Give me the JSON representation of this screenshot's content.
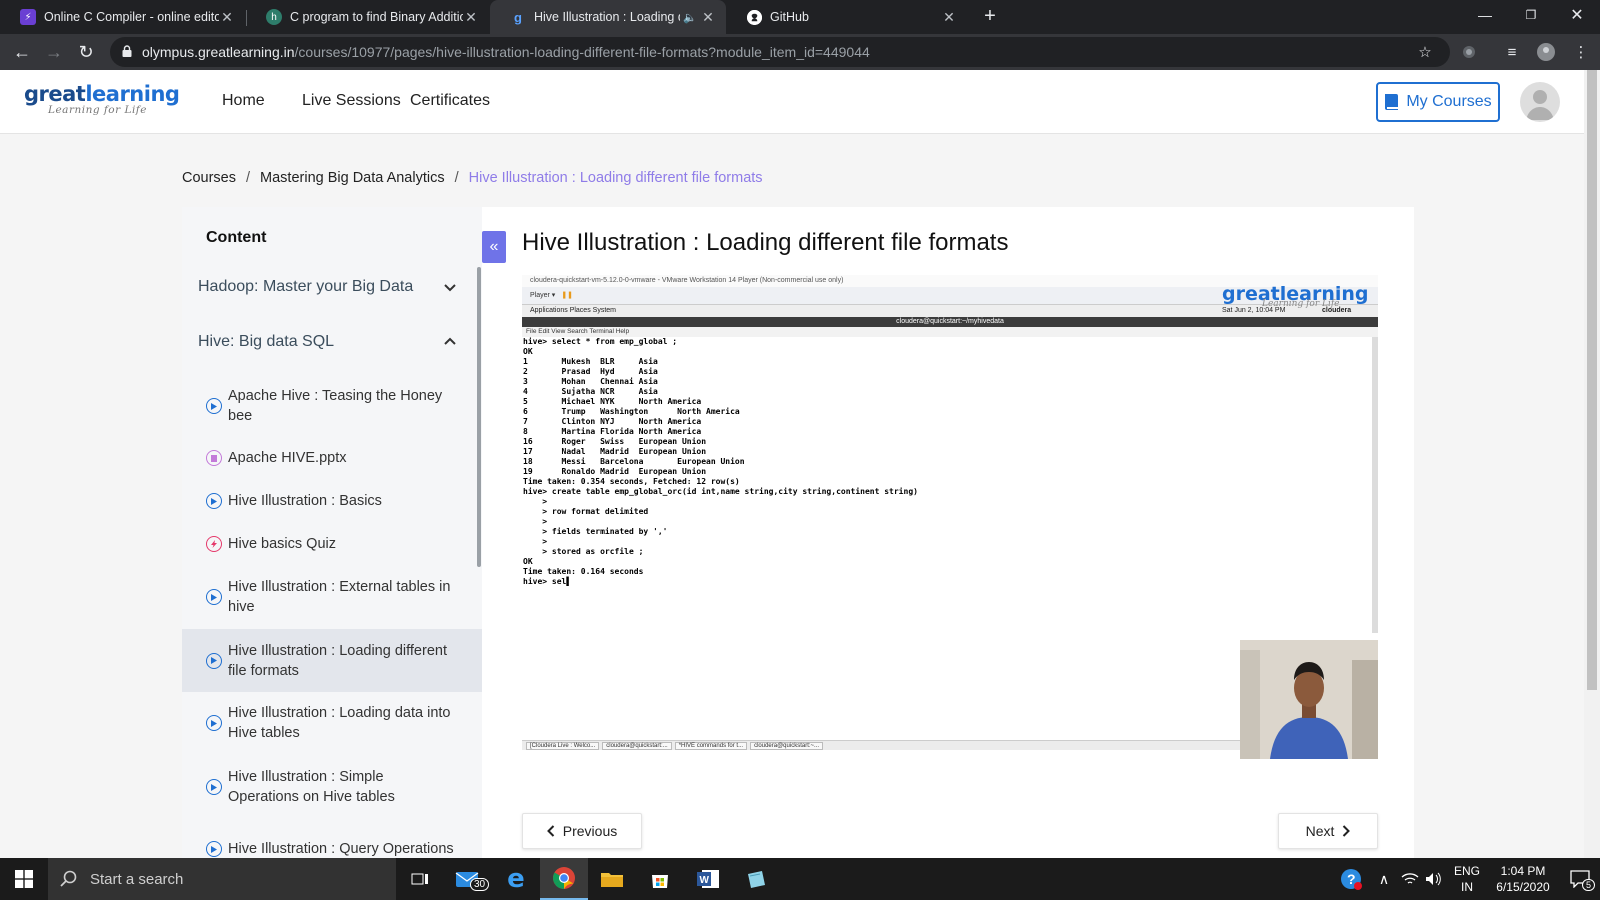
{
  "browser": {
    "tabs": [
      {
        "title": "Online C Compiler - online editor",
        "icon": "bolt-icon",
        "color": "#6a3fd3"
      },
      {
        "title": "C program to find Binary Additio",
        "icon": "site-icon",
        "color": "#2e7d6b"
      },
      {
        "title": "Hive Illustration : Loading dif",
        "icon": "greatlearning-icon",
        "color": "#1f6fd1"
      },
      {
        "title": "GitHub",
        "icon": "github-icon",
        "color": "#ffffff"
      }
    ],
    "url_host": "olympus.greatlearning.in",
    "url_path": "/courses/10977/pages/hive-illustration-loading-different-file-formats?module_item_id=449044"
  },
  "site": {
    "logo_main": "greatlearning",
    "logo_tagline": "Learning for Life",
    "nav": [
      "Home",
      "Live Sessions",
      "Certificates"
    ],
    "my_courses": "My Courses",
    "brand_color": "#1f6fd1"
  },
  "breadcrumb": {
    "items": [
      "Courses",
      "Mastering Big Data Analytics"
    ],
    "current": "Hive Illustration : Loading different file formats",
    "separator": "/"
  },
  "sidebar": {
    "title": "Content",
    "modules": [
      {
        "label": "Hadoop: Master your Big Data",
        "state": "collapsed"
      },
      {
        "label": "Hive: Big data SQL",
        "state": "expanded"
      }
    ],
    "lessons": [
      {
        "label": "Apache Hive : Teasing the Honey bee",
        "type": "video"
      },
      {
        "label": "Apache HIVE.pptx",
        "type": "pptx"
      },
      {
        "label": "Hive Illustration : Basics",
        "type": "video"
      },
      {
        "label": "Hive basics Quiz",
        "type": "quiz"
      },
      {
        "label": "Hive Illustration : External tables in hive",
        "type": "video"
      },
      {
        "label": "Hive Illustration : Loading different file formats",
        "type": "video",
        "active": true
      },
      {
        "label": "Hive Illustration : Loading data into Hive tables",
        "type": "video"
      },
      {
        "label": "Hive Illustration : Simple Operations on Hive tables",
        "type": "video"
      },
      {
        "label": "Hive Illustration : Query Operations",
        "type": "video"
      }
    ]
  },
  "main": {
    "title": "Hive Illustration : Loading different file formats",
    "prev_label": "Previous",
    "next_label": "Next"
  },
  "video": {
    "vm_title": "cloudera-quickstart-vm-5.12.0-0-vmware - VMware Workstation 14 Player (Non-commercial use only)",
    "vm_player": "Player ▾",
    "vm_apps": "Applications   Places   System",
    "vm_clock": "Sat Jun 2, 10:04 PM",
    "vm_user": "cloudera",
    "terminal_title": "cloudera@quickstart:~/myhivedata",
    "terminal_menu": "File   Edit   View   Search   Terminal   Help",
    "watermark_main": "greatlearning",
    "watermark_tagline": "Learning for Life",
    "terminal_lines": [
      "hive> select * from emp_global ;",
      "OK",
      "1       Mukesh  BLR     Asia",
      "2       Prasad  Hyd     Asia",
      "3       Mohan   Chennai Asia",
      "4       Sujatha NCR     Asia",
      "5       Michael NYK     North America",
      "6       Trump   Washington      North America",
      "7       Clinton NYJ     North America",
      "8       Martina Florida North America",
      "16      Roger   Swiss   European Union",
      "17      Nadal   Madrid  European Union",
      "18      Messi   Barcelona       European Union",
      "19      Ronaldo Madrid  European Union",
      "Time taken: 0.354 seconds, Fetched: 12 row(s)",
      "hive> create table emp_global_orc(id int,name string,city string,continent string)",
      "    >",
      "    > row format delimited",
      "    >",
      "    > fields terminated by ','",
      "    >",
      "    > stored as orcfile ;",
      "OK",
      "Time taken: 0.164 seconds",
      "hive> sel▌"
    ],
    "vm_taskbar": [
      "[Cloudera Live : Welco...",
      "cloudera@quickstart:...",
      "*HIVE commands for t...",
      "cloudera@quickstart:~..."
    ]
  },
  "os_taskbar": {
    "search_placeholder": "Start a search",
    "mail_badge": "30",
    "lang": "ENG",
    "region": "IN",
    "time": "1:04 PM",
    "date": "6/15/2020",
    "notif_count": "5"
  }
}
